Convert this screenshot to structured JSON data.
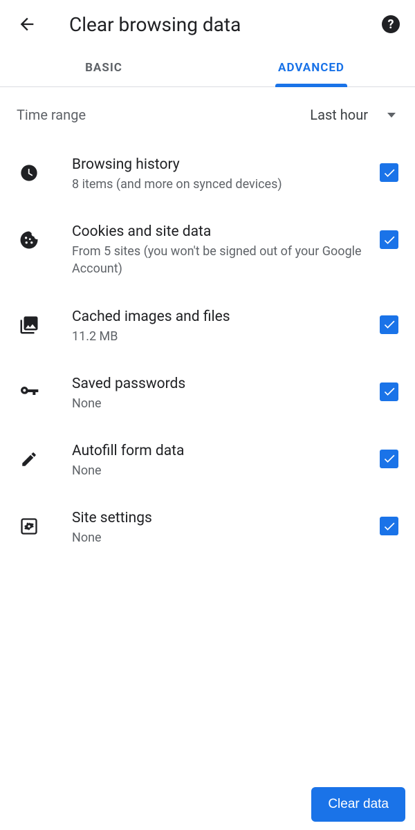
{
  "header": {
    "title": "Clear browsing data"
  },
  "tabs": {
    "basic": "BASIC",
    "advanced": "ADVANCED"
  },
  "time_range": {
    "label": "Time range",
    "value": "Last hour"
  },
  "items": [
    {
      "icon": "clock-icon",
      "title": "Browsing history",
      "subtitle": "8 items (and more on synced devices)",
      "checked": true
    },
    {
      "icon": "cookie-icon",
      "title": "Cookies and site data",
      "subtitle": "From 5 sites (you won't be signed out of your Google Account)",
      "checked": true
    },
    {
      "icon": "image-stack-icon",
      "title": "Cached images and files",
      "subtitle": "11.2 MB",
      "checked": true
    },
    {
      "icon": "key-icon",
      "title": "Saved passwords",
      "subtitle": "None",
      "checked": true
    },
    {
      "icon": "pencil-icon",
      "title": "Autofill form data",
      "subtitle": "None",
      "checked": true
    },
    {
      "icon": "site-settings-icon",
      "title": "Site settings",
      "subtitle": "None",
      "checked": true
    }
  ],
  "footer": {
    "clear_button": "Clear data"
  },
  "colors": {
    "accent": "#1a73e8",
    "text_primary": "#202124",
    "text_secondary": "#5f6368"
  }
}
